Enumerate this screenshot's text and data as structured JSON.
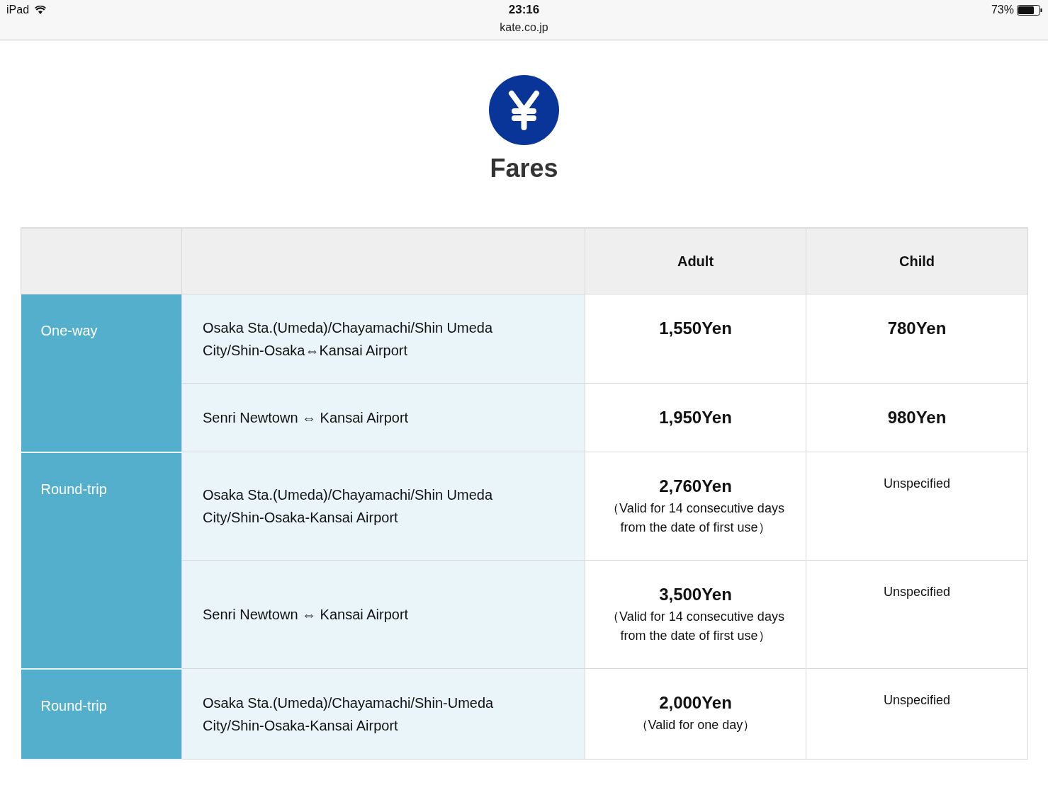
{
  "status_bar": {
    "device": "iPad",
    "time": "23:16",
    "url": "kate.co.jp",
    "battery": "73%"
  },
  "heading": {
    "title": "Fares"
  },
  "table": {
    "columns": [
      "Adult",
      "Child"
    ],
    "groups": [
      {
        "label": "One-way",
        "rows": [
          {
            "route": "Osaka Sta.(Umeda)/Chayamachi/Shin Umeda City/Shin-Osaka⇔Kansai Airport",
            "adult": {
              "price": "1,550Yen"
            },
            "child": {
              "kind": "price",
              "text": "780Yen"
            }
          },
          {
            "route": "Senri Newtown ⇔ Kansai Airport",
            "adult": {
              "price": "1,950Yen"
            },
            "child": {
              "kind": "price",
              "text": "980Yen"
            }
          }
        ]
      },
      {
        "label": "Round-trip",
        "rows": [
          {
            "route": "Osaka Sta.(Umeda)/Chayamachi/Shin Umeda City/Shin-Osaka-Kansai Airport",
            "adult": {
              "price": "2,760Yen",
              "note": "（Valid for 14 consecutive days from the date of first use）"
            },
            "child": {
              "kind": "note",
              "text": "Unspecified"
            }
          },
          {
            "route": "Senri Newtown ⇔ Kansai Airport",
            "adult": {
              "price": "3,500Yen",
              "note": "（Valid for 14 consecutive days from the date of first use）"
            },
            "child": {
              "kind": "note",
              "text": "Unspecified"
            }
          }
        ]
      },
      {
        "label": "Round-trip",
        "rows": [
          {
            "route": "Osaka Sta.(Umeda)/Chayamachi/Shin-Umeda City/Shin-Osaka-Kansai Airport",
            "adult": {
              "price": "2,000Yen",
              "note": "（Valid for one day）"
            },
            "child": {
              "kind": "note",
              "text": "Unspecified"
            }
          }
        ]
      }
    ]
  }
}
